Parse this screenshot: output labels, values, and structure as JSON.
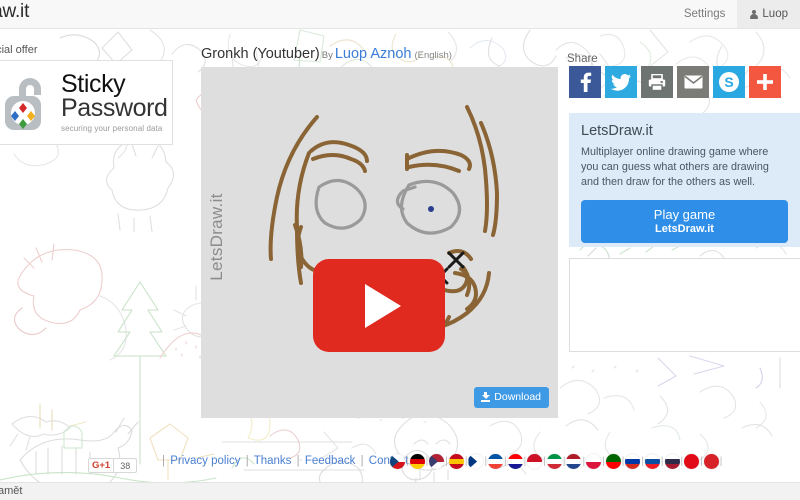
{
  "topbar": {
    "brand": "raw.it",
    "items": [
      {
        "label": "Settings",
        "name": "nav-settings",
        "active": false
      },
      {
        "label": "Luop",
        "name": "nav-user",
        "active": true
      }
    ]
  },
  "ad_left": {
    "offer_label": "ecial offer",
    "title_line1": "Sticky",
    "title_line2": "Password",
    "tagline": "securing your personal data",
    "logo_icon": "padlock-icon"
  },
  "drawing": {
    "title": "Gronkh (Youtuber)",
    "by_label": "By",
    "author": "Luop Aznoh",
    "language": "(English)",
    "watermark": "LetsDraw.it",
    "play_overlay_icon": "youtube-play-icon",
    "download_label": "Download",
    "download_icon": "download-icon",
    "canvas_bg": "#dedede",
    "stroke_color": "#8a6434",
    "glasses_color": "#9a9a9a",
    "mouth_color": "#1a1a1a"
  },
  "share": {
    "label": "Share",
    "buttons": [
      {
        "name": "share-facebook",
        "icon": "facebook-icon",
        "glyph": "f",
        "color": "#3b5998"
      },
      {
        "name": "share-twitter",
        "icon": "twitter-icon",
        "glyph": "t",
        "color": "#2eaae0"
      },
      {
        "name": "share-print",
        "icon": "printer-icon",
        "glyph": "p",
        "color": "#6d7471"
      },
      {
        "name": "share-email",
        "icon": "envelope-icon",
        "glyph": "m",
        "color": "#7b7b78"
      },
      {
        "name": "share-skype",
        "icon": "skype-icon",
        "glyph": "S",
        "color": "#29a8e1"
      },
      {
        "name": "share-more",
        "icon": "plus-icon",
        "glyph": "+",
        "color": "#f4573f"
      }
    ]
  },
  "info_panel": {
    "title": "LetsDraw.it",
    "description": "Multiplayer online drawing game where you can guess what others are drawing and then draw for the others as well.",
    "button_line1": "Play game",
    "button_line2": "LetsDraw.it",
    "bg_color": "#dcebf7",
    "button_color": "#2f8fe8"
  },
  "footer": {
    "gplus_label": "G+1",
    "gplus_count": "38",
    "leading_sep": "|",
    "links": [
      "Privacy policy",
      "Thanks",
      "Feedback",
      "Contact"
    ],
    "separator": "|",
    "flags": [
      {
        "name": "flag-cz",
        "title": "Czech",
        "top": "#ffffff",
        "bottom": "#d7141a",
        "wedge": "#11457e"
      },
      {
        "name": "flag-de",
        "title": "German",
        "top": "#000000",
        "mid": "#dd0000",
        "bottom": "#ffce00"
      },
      {
        "name": "flag-us",
        "title": "English",
        "top": "#b22234",
        "bottom": "#ffffff",
        "wedge": "#3c3b6e"
      },
      {
        "name": "flag-es",
        "title": "Spanish",
        "top": "#c60b1e",
        "mid": "#ffc400",
        "bottom": "#c60b1e"
      },
      {
        "name": "flag-fi",
        "title": "Finnish",
        "top": "#ffffff",
        "bottom": "#ffffff",
        "wedge": "#003580"
      },
      {
        "name": "flag-fr",
        "title": "French",
        "top": "#0055a4",
        "mid": "#ffffff",
        "bottom": "#ef4135"
      },
      {
        "name": "flag-hr",
        "title": "Croatian",
        "top": "#ff0000",
        "mid": "#ffffff",
        "bottom": "#171796"
      },
      {
        "name": "flag-id",
        "title": "Indonesian",
        "top": "#ce1126",
        "bottom": "#ffffff"
      },
      {
        "name": "flag-it",
        "title": "Italian",
        "top": "#009246",
        "mid": "#ffffff",
        "bottom": "#ce2b37"
      },
      {
        "name": "flag-nl",
        "title": "Dutch",
        "top": "#ae1c28",
        "mid": "#ffffff",
        "bottom": "#21468b"
      },
      {
        "name": "flag-pl",
        "title": "Polish",
        "top": "#ffffff",
        "bottom": "#dc143c"
      },
      {
        "name": "flag-pt",
        "title": "Portuguese",
        "top": "#006600",
        "bottom": "#ff0000"
      },
      {
        "name": "flag-ru",
        "title": "Russian",
        "top": "#ffffff",
        "mid": "#0039a6",
        "bottom": "#d52b1e"
      },
      {
        "name": "flag-sk",
        "title": "Slovak",
        "top": "#ffffff",
        "mid": "#0b4ea2",
        "bottom": "#ee1c25"
      },
      {
        "name": "flag-th",
        "title": "Thai",
        "top": "#ffffff",
        "mid": "#2d2a4a",
        "bottom": "#a51931"
      },
      {
        "name": "flag-tr",
        "title": "Turkish",
        "top": "#e30a17",
        "bottom": "#e30a17"
      },
      {
        "name": "flag-other",
        "title": "Other",
        "top": "#d8222a",
        "bottom": "#d8222a"
      }
    ]
  },
  "bottom_chrome": {
    "text": "amět"
  }
}
